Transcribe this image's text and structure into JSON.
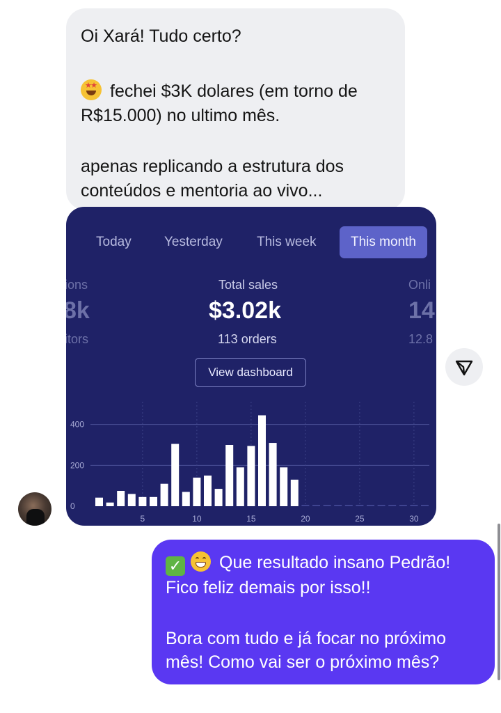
{
  "incoming_message": {
    "lines": [
      "Oi Xará! Tudo certo?",
      "fechei $3K dolares (em torno de",
      "R$15.000) no ultimo mês.",
      "apenas replicando a estrutura dos",
      "conteúdos e mentoria ao vivo..."
    ],
    "emoji": "star-struck-emoji"
  },
  "screenshot": {
    "tabs": [
      {
        "label": "Today"
      },
      {
        "label": "Yesterday"
      },
      {
        "label": "This week"
      },
      {
        "label": "This month",
        "active": true
      }
    ],
    "left_stat": {
      "label": "ions",
      "value": "8k",
      "sub": "itors"
    },
    "center_stat": {
      "label": "Total sales",
      "value": "$3.02k",
      "sub": "113 orders"
    },
    "right_stat": {
      "label": "Onli",
      "value": "14",
      "sub": "12.8"
    },
    "dashboard_button": "View dashboard"
  },
  "chart_data": {
    "type": "bar",
    "x": [
      1,
      2,
      3,
      4,
      5,
      6,
      7,
      8,
      9,
      10,
      11,
      12,
      13,
      14,
      15,
      16,
      17,
      18,
      19,
      20,
      21,
      22,
      23,
      24,
      25,
      26,
      27,
      28,
      29,
      30,
      31
    ],
    "values": [
      42,
      18,
      75,
      60,
      45,
      45,
      110,
      305,
      70,
      140,
      150,
      85,
      300,
      190,
      295,
      445,
      310,
      190,
      130,
      0,
      0,
      0,
      0,
      0,
      0,
      0,
      0,
      0,
      0,
      0,
      0
    ],
    "xticks": [
      5,
      10,
      15,
      20,
      25,
      30
    ],
    "yticks": [
      0,
      200,
      400
    ],
    "ylim": [
      0,
      450
    ],
    "title": "",
    "xlabel": "",
    "ylabel": ""
  },
  "outgoing_message": {
    "lines": [
      "Que resultado insano Pedrão!",
      "Fico feliz demais por isso!!",
      "Bora com tudo e já focar no próximo",
      "mês! Como vai ser o próximo mês?"
    ],
    "emojis": [
      "check-mark-emoji",
      "grinning-emoji"
    ]
  },
  "colors": {
    "incoming_bubble": "#eeeff2",
    "outgoing_bubble": "#5a38f2",
    "screenshot_bg": "#1f2267",
    "active_tab": "#5d63c9"
  }
}
